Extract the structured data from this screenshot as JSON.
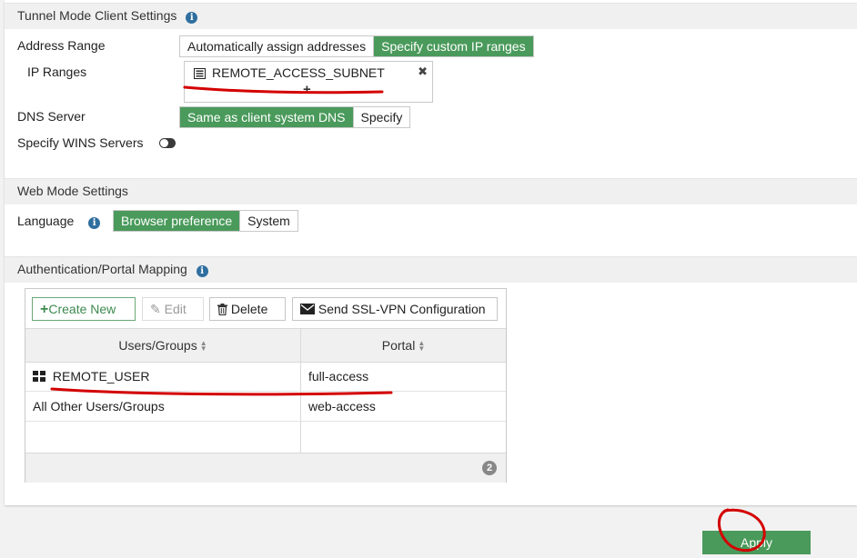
{
  "tunnel": {
    "title": "Tunnel Mode Client Settings",
    "address_range_label": "Address Range",
    "address_options": [
      "Automatically assign addresses",
      "Specify custom IP ranges"
    ],
    "ip_ranges_label": "IP Ranges",
    "ip_range_entry": "REMOTE_ACCESS_SUBNET",
    "add_symbol": "+",
    "remove_symbol": "✖",
    "dns_label": "DNS Server",
    "dns_options": [
      "Same as client system DNS",
      "Specify"
    ],
    "wins_label": "Specify WINS Servers",
    "wins_enabled": false
  },
  "web": {
    "title": "Web Mode Settings",
    "language_label": "Language",
    "language_options": [
      "Browser preference",
      "System"
    ]
  },
  "auth": {
    "title": "Authentication/Portal Mapping",
    "toolbar": {
      "create_new": "Create New",
      "edit": "Edit",
      "delete": "Delete",
      "send_config": "Send SSL-VPN Configuration"
    },
    "columns": [
      "Users/Groups",
      "Portal"
    ],
    "rows": [
      {
        "user": "REMOTE_USER",
        "portal": "full-access"
      },
      {
        "user": "All Other Users/Groups",
        "portal": "web-access"
      }
    ],
    "count": "2"
  },
  "footer": {
    "apply": "Apply"
  },
  "colors": {
    "accent": "#4a9a5b",
    "annotation": "#d40000"
  }
}
